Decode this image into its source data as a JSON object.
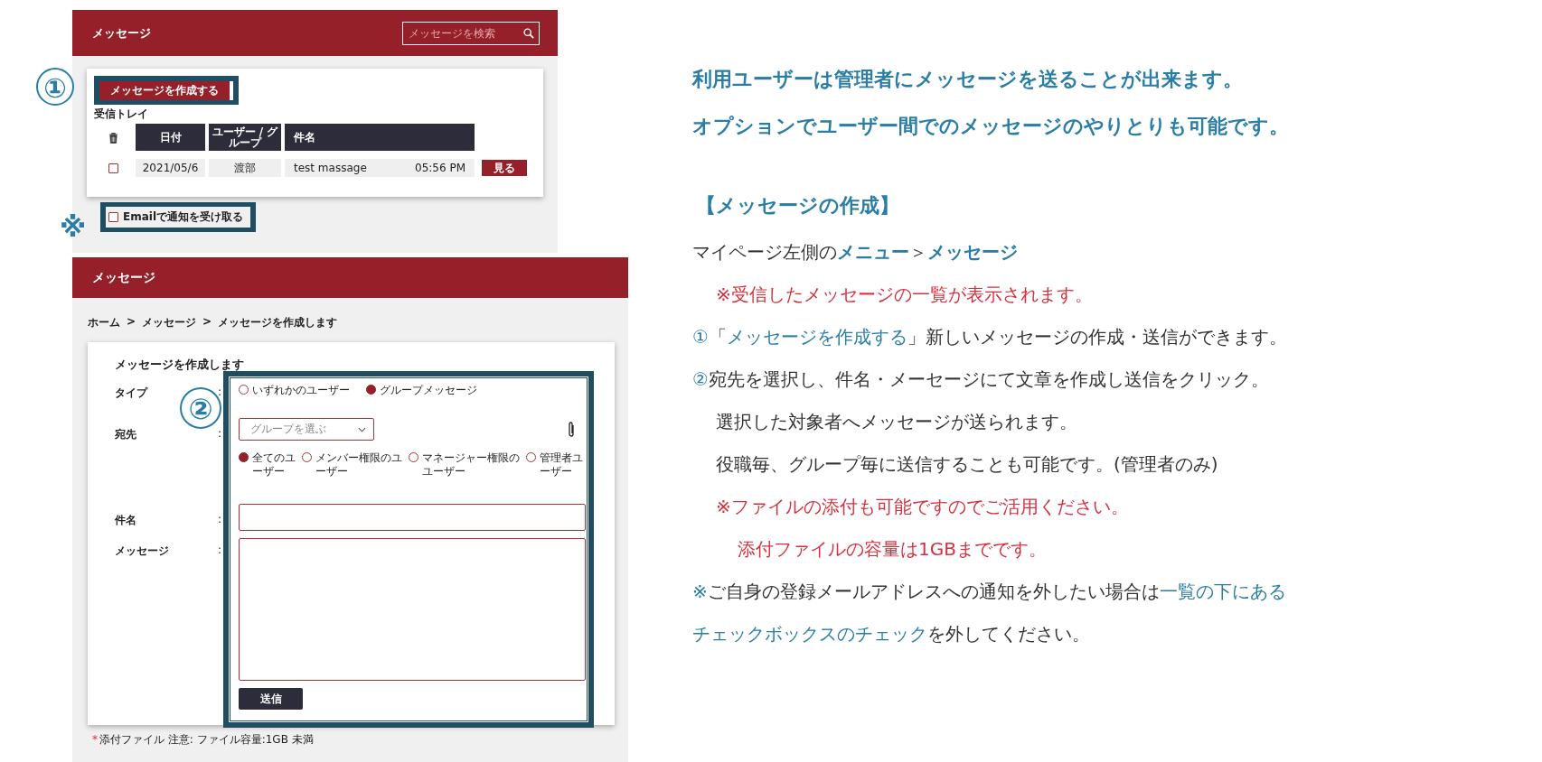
{
  "inbox_screen": {
    "header_title": "メッセージ",
    "search": {
      "placeholder": "メッセージを検索"
    },
    "marker": "①",
    "compose_button": "メッセージを作成する",
    "inbox_label": "受信トレイ",
    "table": {
      "columns": [
        "日付",
        "ユーザー / グループ",
        "件名"
      ],
      "rows": [
        {
          "checked": false,
          "date": "2021/05/6",
          "user": "渡部",
          "subject": "test massage",
          "time": "05:56 PM",
          "action": "見る"
        }
      ]
    },
    "email_option": {
      "marker": "※",
      "label": "Emailで通知を受け取る",
      "checked": false
    }
  },
  "compose_screen": {
    "header_title": "メッセージ",
    "breadcrumb": {
      "items": [
        "ホーム",
        "メッセージ",
        "メッセージを作成します"
      ],
      "separators": [
        ">",
        ">"
      ]
    },
    "form_title": "メッセージを作成します",
    "marker": "②",
    "rows": [
      {
        "kind": "radio",
        "label": "タイプ",
        "colon": ":",
        "options": [
          {
            "label": "いずれかのユーザー",
            "selected": false
          },
          {
            "label": "グループメッセージ",
            "selected": true
          }
        ]
      },
      {
        "kind": "select",
        "label": "宛先",
        "colon": ":",
        "placeholder": "グループを選ぶ",
        "options": [
          {
            "label": "全てのユーザー",
            "selected": true
          },
          {
            "label": "メンバー権限のユーザー",
            "selected": false
          },
          {
            "label": "マネージャー権限のユーザー",
            "selected": false
          },
          {
            "label": "管理者ユーザー",
            "selected": false
          }
        ]
      },
      {
        "kind": "text",
        "label": "件名",
        "colon": ":"
      },
      {
        "kind": "textarea",
        "label": "メッセージ",
        "colon": ":"
      }
    ],
    "send_button": "送信",
    "note": {
      "asterisk": "*",
      "text": "添付ファイル 注意: ファイル容量:1GB 未満"
    }
  },
  "explanation": {
    "intro": [
      "利用ユーザーは管理者にメッセージを送ることが出来ます。",
      "オプションでユーザー間でのメッセージのやりとりも可能です。"
    ],
    "heading": "【メッセージの作成】",
    "lines": [
      {
        "kind": "line",
        "segments": [
          {
            "kind": "plain",
            "text": "マイページ左側の"
          },
          {
            "kind": "strong",
            "text": "メニュー"
          },
          {
            "kind": "plain",
            "text": "＞"
          },
          {
            "kind": "strong",
            "text": "メッセージ"
          }
        ]
      },
      {
        "kind": "sub",
        "segments": [
          {
            "kind": "alert",
            "text": "※受信したメッセージの一覧が表示されます。"
          }
        ]
      },
      {
        "kind": "line",
        "segments": [
          {
            "kind": "accent",
            "text": "①"
          },
          {
            "kind": "plain",
            "text": "「"
          },
          {
            "kind": "accent",
            "text": "メッセージを作成する"
          },
          {
            "kind": "plain",
            "text": "」新しいメッセージの作成・送信ができます。"
          }
        ]
      },
      {
        "kind": "line",
        "segments": [
          {
            "kind": "accent",
            "text": "②"
          },
          {
            "kind": "plain",
            "text": "宛先を選択し、件名・メーセージにて文章を作成し送信をクリック。"
          }
        ]
      },
      {
        "kind": "sub",
        "segments": [
          {
            "kind": "plain",
            "text": "選択した対象者へメッセージが送られます。"
          }
        ]
      },
      {
        "kind": "sub",
        "segments": [
          {
            "kind": "plain",
            "text": "役職毎、グループ毎に送信することも可能です。(管理者のみ)"
          }
        ]
      },
      {
        "kind": "sub",
        "segments": [
          {
            "kind": "alert",
            "text": "※ファイルの添付も可能ですのでご活用ください。"
          }
        ]
      },
      {
        "kind": "subsub",
        "segments": [
          {
            "kind": "alert",
            "text": "添付ファイルの容量は1GBまでです。"
          }
        ]
      },
      {
        "kind": "line",
        "segments": [
          {
            "kind": "accent",
            "text": "※"
          },
          {
            "kind": "plain",
            "text": "ご自身の登録メールアドレスへの通知を外したい場合は"
          },
          {
            "kind": "accent",
            "text": "一覧の下にある"
          }
        ]
      },
      {
        "kind": "line",
        "segments": [
          {
            "kind": "accent",
            "text": "チェックボックスのチェック"
          },
          {
            "kind": "plain",
            "text": "を外してください。"
          }
        ]
      }
    ]
  }
}
